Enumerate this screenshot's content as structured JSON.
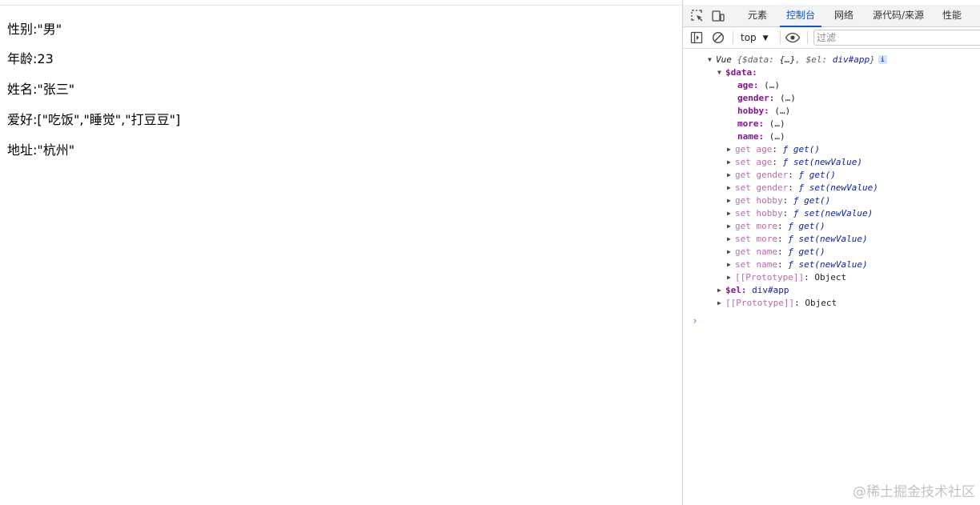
{
  "page": {
    "lines": [
      "性别:\"男\"",
      "年龄:23",
      "姓名:\"张三\"",
      "爱好:[\"吃饭\",\"睡觉\",\"打豆豆\"]",
      "地址:\"杭州\""
    ]
  },
  "devtools": {
    "tabs": [
      "元素",
      "控制台",
      "网络",
      "源代码/来源",
      "性能"
    ],
    "active_tab": "控制台",
    "accent_color": "#0b57d0",
    "toolbar": {
      "context": "top",
      "filter_placeholder": "过滤"
    },
    "console": {
      "root": {
        "name": "Vue",
        "summary_open": "{",
        "data_key": "$data",
        "data_val": "{…}",
        "el_key": "$el",
        "el_val": "div#app",
        "summary_close": "}",
        "info": "i"
      },
      "data_header": "$data",
      "props": [
        {
          "key": "age",
          "val": "(…)"
        },
        {
          "key": "gender",
          "val": "(…)"
        },
        {
          "key": "hobby",
          "val": "(…)"
        },
        {
          "key": "more",
          "val": "(…)"
        },
        {
          "key": "name",
          "val": "(…)"
        }
      ],
      "accessors": [
        {
          "label": "get age",
          "f": "ƒ",
          "sig": "get()"
        },
        {
          "label": "set age",
          "f": "ƒ",
          "sig": "set(newValue)"
        },
        {
          "label": "get gender",
          "f": "ƒ",
          "sig": "get()"
        },
        {
          "label": "set gender",
          "f": "ƒ",
          "sig": "set(newValue)"
        },
        {
          "label": "get hobby",
          "f": "ƒ",
          "sig": "get()"
        },
        {
          "label": "set hobby",
          "f": "ƒ",
          "sig": "set(newValue)"
        },
        {
          "label": "get more",
          "f": "ƒ",
          "sig": "get()"
        },
        {
          "label": "set more",
          "f": "ƒ",
          "sig": "set(newValue)"
        },
        {
          "label": "get name",
          "f": "ƒ",
          "sig": "get()"
        },
        {
          "label": "set name",
          "f": "ƒ",
          "sig": "set(newValue)"
        }
      ],
      "data_proto": {
        "key": "[[Prototype]]",
        "val": "Object"
      },
      "el_line": {
        "key": "$el",
        "val": "div#app"
      },
      "root_proto": {
        "key": "[[Prototype]]",
        "val": "Object"
      },
      "prompt": "›"
    }
  },
  "watermark": "@稀土掘金技术社区"
}
